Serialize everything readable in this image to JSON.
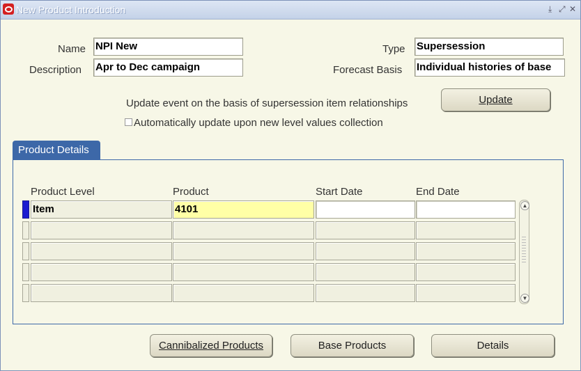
{
  "window": {
    "title": "New Product Introduction",
    "controls": [
      "⤓",
      "⤢",
      "✕"
    ]
  },
  "form": {
    "name_label": "Name",
    "name_value": "NPI New",
    "description_label": "Description",
    "description_value": "Apr to Dec campaign",
    "type_label": "Type",
    "type_value": "Supersession",
    "forecast_label": "Forecast Basis",
    "forecast_value": "Individual histories of base",
    "update_text": "Update event on the basis of supersession item relationships",
    "update_button": "Update",
    "auto_update_label": "Automatically update upon new level values collection"
  },
  "product_details": {
    "tab_label": "Product Details",
    "columns": [
      "Product Level",
      "Product",
      "Start Date",
      "End Date"
    ],
    "rows": [
      [
        "Item",
        "4101",
        "",
        ""
      ],
      [
        "",
        "",
        "",
        ""
      ],
      [
        "",
        "",
        "",
        ""
      ],
      [
        "",
        "",
        "",
        ""
      ],
      [
        "",
        "",
        "",
        ""
      ]
    ]
  },
  "footer": {
    "cannibalized_button": "Cannibalized Products",
    "base_button": "Base Products",
    "details_button": "Details"
  },
  "colors": {
    "background": "#f7f7e7",
    "tab_blue": "#3d68a8",
    "active_cell": "#ffffa6",
    "row_indicator": "#1c1cd0"
  }
}
